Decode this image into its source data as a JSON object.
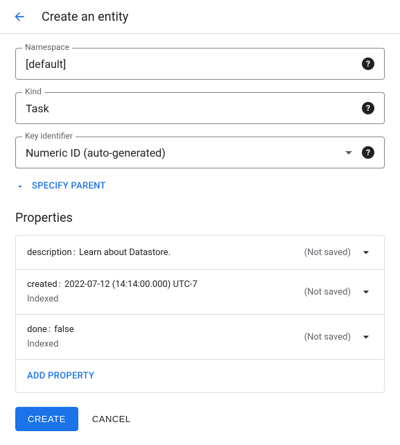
{
  "header": {
    "title": "Create an entity"
  },
  "fields": {
    "namespace": {
      "label": "Namespace",
      "value": "[default]"
    },
    "kind": {
      "label": "Kind",
      "value": "Task"
    },
    "keyIdentifier": {
      "label": "Key identifier",
      "value": "Numeric ID (auto-generated)"
    }
  },
  "specifyParentLabel": "SPECIFY PARENT",
  "propertiesTitle": "Properties",
  "notSavedLabel": "(Not saved)",
  "indexedLabel": "Indexed",
  "properties": [
    {
      "name": "description",
      "value": "Learn about Datastore.",
      "indexed": false
    },
    {
      "name": "created",
      "value": "2022-07-12 (14:14:00.000) UTC-7",
      "indexed": true
    },
    {
      "name": "done",
      "value": "false",
      "indexed": true
    }
  ],
  "addPropertyLabel": "ADD PROPERTY",
  "buttons": {
    "create": "CREATE",
    "cancel": "CANCEL"
  }
}
